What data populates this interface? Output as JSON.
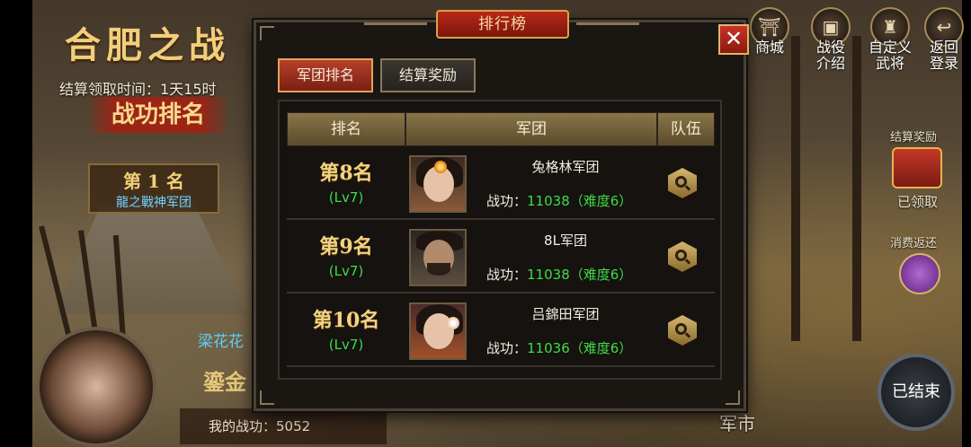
{
  "background": {
    "title": "合肥之战",
    "settle_time": "结算领取时间：1天15时",
    "rank_title": "战功排名",
    "first_place": {
      "rank": "第 1 名",
      "legion": "龍之戰神军团"
    },
    "player_name": "梁花花",
    "gold_text": "鎏金",
    "my_merit": "我的战功：5052",
    "right_menu": [
      {
        "label": "商城",
        "icon": "shop-icon",
        "glyph": "⛩"
      },
      {
        "label": "战役\n介绍",
        "icon": "battle-intro-icon",
        "glyph": "▣"
      },
      {
        "label": "自定义\n武将",
        "icon": "custom-general-icon",
        "glyph": "♜"
      },
      {
        "label": "返回\n登录",
        "icon": "return-login-icon",
        "glyph": "↩"
      }
    ],
    "settle_reward_label": "结算奖励",
    "claimed_label": "已领取",
    "consume_rebate_label": "消费返还",
    "ended_label": "已结束",
    "market_label": "军市"
  },
  "panel": {
    "title": "排行榜",
    "close": "✕",
    "tabs": [
      {
        "label": "军团排名",
        "active": true
      },
      {
        "label": "结算奖励",
        "active": false
      }
    ],
    "columns": [
      "排名",
      "军团",
      "队伍"
    ],
    "rows": [
      {
        "rank": "第8名",
        "level": "(Lv7)",
        "legion": "兔格林军团",
        "merit_label": "战功：",
        "merit_value": "11038（难度6）",
        "portrait": "female"
      },
      {
        "rank": "第9名",
        "level": "(Lv7)",
        "legion": "8L军团",
        "merit_label": "战功：",
        "merit_value": "11038（难度6）",
        "portrait": "male"
      },
      {
        "rank": "第10名",
        "level": "(Lv7)",
        "legion": "吕錦田军团",
        "merit_label": "战功：",
        "merit_value": "11036（难度6）",
        "portrait": "female"
      }
    ]
  },
  "colors": {
    "accent_red": "#9b2414",
    "gold_text": "#f3d382",
    "level_green": "#3fdc47"
  }
}
